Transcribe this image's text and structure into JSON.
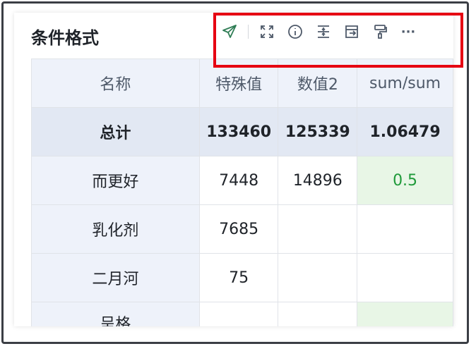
{
  "card": {
    "title": "条件格式",
    "toolbar": [
      {
        "name": "send-icon"
      },
      {
        "name": "fullscreen-icon"
      },
      {
        "name": "info-icon"
      },
      {
        "name": "compress-icon"
      },
      {
        "name": "export-icon"
      },
      {
        "name": "paint-roller-icon"
      },
      {
        "name": "more-icon",
        "glyph": "···"
      }
    ]
  },
  "table": {
    "headers": [
      "名称",
      "特殊值",
      "数值2",
      "sum/sum"
    ],
    "total": [
      "总计",
      "133460",
      "125339",
      "1.06479"
    ],
    "rows": [
      [
        "而更好",
        "7448",
        "14896",
        "0.5"
      ],
      [
        "乳化剂",
        "7685",
        "",
        ""
      ],
      [
        "二月河",
        "75",
        "",
        ""
      ],
      [
        "呈格",
        "",
        "",
        ""
      ]
    ]
  },
  "colors": {
    "highlight": "#e60012",
    "header_bg": "#eef2fa",
    "total_bg": "#e2e8f3",
    "positive_bg": "#e8f6e6",
    "positive_text": "#1f9a3a"
  }
}
